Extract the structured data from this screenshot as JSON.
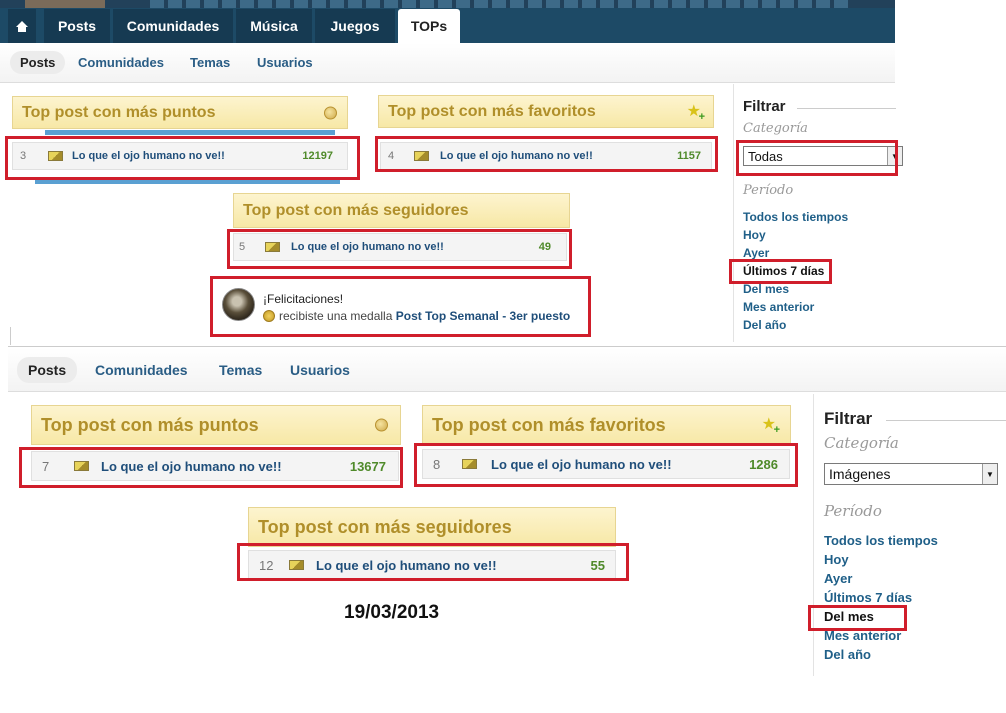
{
  "nav": {
    "home_icon": "home-icon",
    "tabs": [
      {
        "label": "Posts",
        "active": false
      },
      {
        "label": "Comunidades",
        "active": false
      },
      {
        "label": "Música",
        "active": false
      },
      {
        "label": "Juegos",
        "active": false
      },
      {
        "label": "TOPs",
        "active": true
      }
    ]
  },
  "colors": {
    "nav_bg": "#1d4a66",
    "card_header_bg": "#f7e8a6",
    "card_header_text": "#b08f2a",
    "link": "#1f4e7a",
    "score": "#4f8a2a",
    "highlight_border": "#d01e2b"
  },
  "top_panel": {
    "subnav": [
      "Posts",
      "Comunidades",
      "Temas",
      "Usuarios"
    ],
    "active_subnav": "Posts",
    "cards": {
      "puntos": {
        "title": "Top post con más puntos",
        "icon": "coin-icon",
        "rank": "3",
        "post_title": "Lo que el ojo humano no ve!!",
        "score": "12197"
      },
      "favoritos": {
        "title": "Top post con más favoritos",
        "icon": "star-add-icon",
        "rank": "4",
        "post_title": "Lo que el ojo humano no ve!!",
        "score": "1157"
      },
      "seguidores": {
        "title": "Top post con más seguidores",
        "rank": "5",
        "post_title": "Lo que el ojo humano no ve!!",
        "score": "49"
      }
    },
    "medal": {
      "line1": "¡Felicitaciones!",
      "line2_prefix": "recibiste una medalla",
      "medal_name": "Post Top Semanal - 3er puesto"
    },
    "filter": {
      "title": "Filtrar",
      "category_label": "Categoría",
      "category_value": "Todas",
      "period_label": "Período",
      "periods": [
        "Todos los tiempos",
        "Hoy",
        "Ayer",
        "Últimos 7 días",
        "Del mes",
        "Mes anterior",
        "Del año"
      ],
      "active_period": "Últimos 7 días"
    }
  },
  "bottom_panel": {
    "subnav": [
      "Posts",
      "Comunidades",
      "Temas",
      "Usuarios"
    ],
    "active_subnav": "Posts",
    "cards": {
      "puntos": {
        "title": "Top post con más puntos",
        "icon": "coin-icon",
        "rank": "7",
        "post_title": "Lo que el ojo humano no ve!!",
        "score": "13677"
      },
      "favoritos": {
        "title": "Top post con más favoritos",
        "icon": "star-add-icon",
        "rank": "8",
        "post_title": "Lo que el ojo humano no ve!!",
        "score": "1286"
      },
      "seguidores": {
        "title": "Top post con más seguidores",
        "rank": "12",
        "post_title": "Lo que el ojo humano no ve!!",
        "score": "55"
      }
    },
    "filter": {
      "title": "Filtrar",
      "category_label": "Categoría",
      "category_value": "Imágenes",
      "period_label": "Período",
      "periods": [
        "Todos los tiempos",
        "Hoy",
        "Ayer",
        "Últimos 7 días",
        "Del mes",
        "Mes anterior",
        "Del año"
      ],
      "active_period": "Del mes"
    },
    "date": "19/03/2013"
  }
}
